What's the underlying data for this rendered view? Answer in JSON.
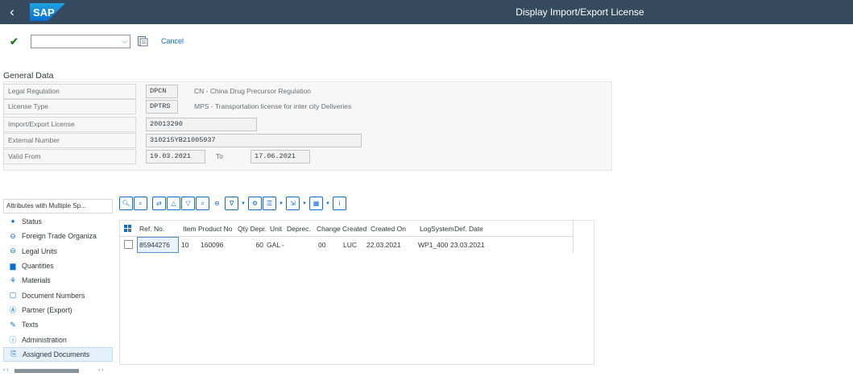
{
  "shell": {
    "back_icon": "back-arrow-icon",
    "logo": "SAP",
    "title": "Display Import/Export License"
  },
  "toolbar": {
    "enter_icon": "check-icon",
    "command_value": "",
    "command_dropdown_icon": "chevron-down-icon",
    "save_icon": "save-icon",
    "cancel_label": "Cancel"
  },
  "general_data": {
    "title": "General Data",
    "fields": [
      {
        "label": "Legal Regulation",
        "value": "DPCN",
        "description": "CN - China Drug Precursor Regulation"
      },
      {
        "label": "License Type",
        "value": "DPTRS",
        "description": "MPS - Transportation license for inter city Deliveries"
      },
      {
        "label": "Import/Export License",
        "value": "20013290"
      },
      {
        "label": "External Number",
        "value": "310215YB21005937"
      },
      {
        "label": "Valid From",
        "value": "19.03.2021",
        "to_label": "To",
        "to_value": "17.06.2021"
      }
    ]
  },
  "nav": {
    "header": "Attributes with Multiple Sp...",
    "items": [
      {
        "label": "Status",
        "icon": "status-icon"
      },
      {
        "label": "Foreign Trade Organiza",
        "icon": "organization-icon"
      },
      {
        "label": "Legal Units",
        "icon": "legal-units-icon"
      },
      {
        "label": "Quantities",
        "icon": "quantities-icon"
      },
      {
        "label": "Materials",
        "icon": "materials-icon"
      },
      {
        "label": "Document Numbers",
        "icon": "document-icon"
      },
      {
        "label": "Partner (Export)",
        "icon": "partner-icon"
      },
      {
        "label": "Texts",
        "icon": "text-icon"
      },
      {
        "label": "Administration",
        "icon": "administration-icon"
      },
      {
        "label": "Assigned Documents",
        "icon": "assigned-documents-icon",
        "selected": true
      }
    ]
  },
  "grid_toolbar": {
    "buttons": [
      "details-icon",
      "find-icon",
      "find-next-icon",
      "sort-ascending-icon",
      "sort-descending-icon",
      "filter-icon",
      "delete-filter-icon",
      "sum-icon",
      "subtotal-icon",
      "print-icon",
      "export-icon",
      "layout-icon",
      "info-icon"
    ]
  },
  "grid": {
    "columns": [
      "Ref. No.",
      "Item",
      "Product No",
      "Qty Depr.",
      "Unit",
      "Deprec.",
      "Change",
      "Created",
      "Created On",
      "LogSystem",
      "Def. Date"
    ],
    "rows": [
      {
        "ref_no": "85944276",
        "item": "10",
        "product_no": "160096",
        "qty_depr": "60",
        "unit": "GAL",
        "deprec": "-",
        "change": "00",
        "created": "LUC",
        "created_on": "22.03.2021",
        "logsystem": "WP1_400",
        "def_date": "23.03.2021"
      }
    ]
  },
  "colors": {
    "shell_bg": "#354a5f",
    "accent": "#0a6ed1",
    "confirm": "#2b7d2b"
  }
}
